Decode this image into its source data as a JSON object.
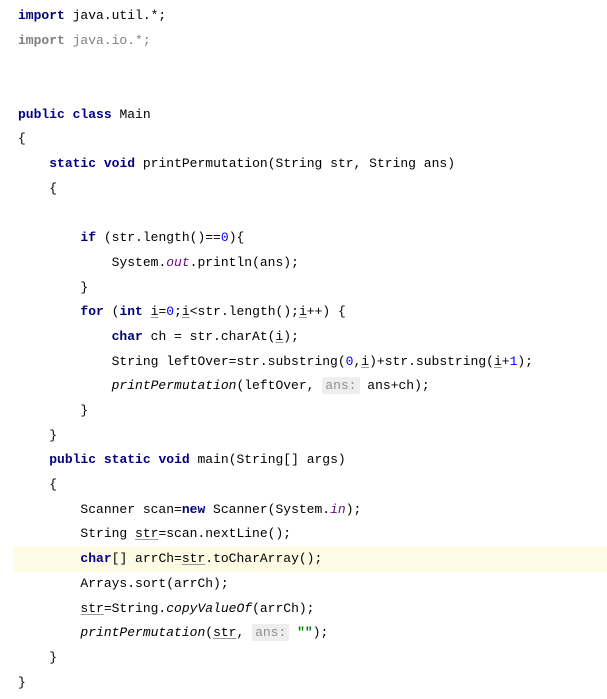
{
  "code": {
    "import1_kw": "import",
    "import1_pkg": " java.util.*;",
    "import2_kw": "import",
    "import2_pkg": " java.io.*;",
    "kw_public": "public",
    "kw_class": "class",
    "kw_static": "static",
    "kw_void": "void",
    "kw_if": "if",
    "kw_for": "for",
    "kw_int": "int",
    "kw_char": "char",
    "kw_new": "new",
    "class_Main": "Main",
    "method_printPermutation": "printPermutation",
    "param_String": "String",
    "param_str": "str",
    "param_ans": "ans",
    "cond_str_len": "(str.length()==",
    "zero": "0",
    "cond_close": "){",
    "system": "System",
    "out": "out",
    "println": ".println(ans);",
    "for_open": "(",
    "for_i_decl": "i",
    "for_assign": "=",
    "for_cond": ";",
    "for_i2": "i",
    "for_cond2": "<str.length();",
    "for_i3": "i",
    "for_cond3": "++) {",
    "char_decl": " ch = str.charAt(",
    "char_i": "i",
    "char_close": ");",
    "leftover_decl": "String leftOver=str.substring(",
    "lo_zero": "0",
    "lo_comma": ",",
    "lo_i": "i",
    "lo_mid": ")+str.substring(",
    "lo_i2": "i",
    "lo_plus1": "+",
    "lo_one": "1",
    "lo_close": ");",
    "pp_call": "printPermutation",
    "pp_args1": "(leftOver, ",
    "hint_ans1": "ans:",
    "pp_args2": " ans+ch);",
    "main_sig1": " main(String[] args)",
    "scanner_decl": "Scanner scan=",
    "scanner_new": " Scanner(System.",
    "in": "in",
    "scanner_close": ");",
    "str_decl": "String ",
    "str_var": "str",
    "str_assign": "=scan.nextLine();",
    "char_arr": "[] arrCh=",
    "str_var2": "str",
    "toCharArray": ".toCharArray();",
    "arrays_sort": "Arrays.sort(arrCh);",
    "str_var3": "str",
    "copy_assign": "=String.",
    "copyValueOf": "copyValueOf",
    "copy_close": "(arrCh);",
    "pp_call2": "printPermutation",
    "pp2_args1": "(",
    "str_var4": "str",
    "pp2_comma": ", ",
    "hint_ans2": "ans:",
    "empty_str": " \"\"",
    "pp2_close": ");"
  }
}
